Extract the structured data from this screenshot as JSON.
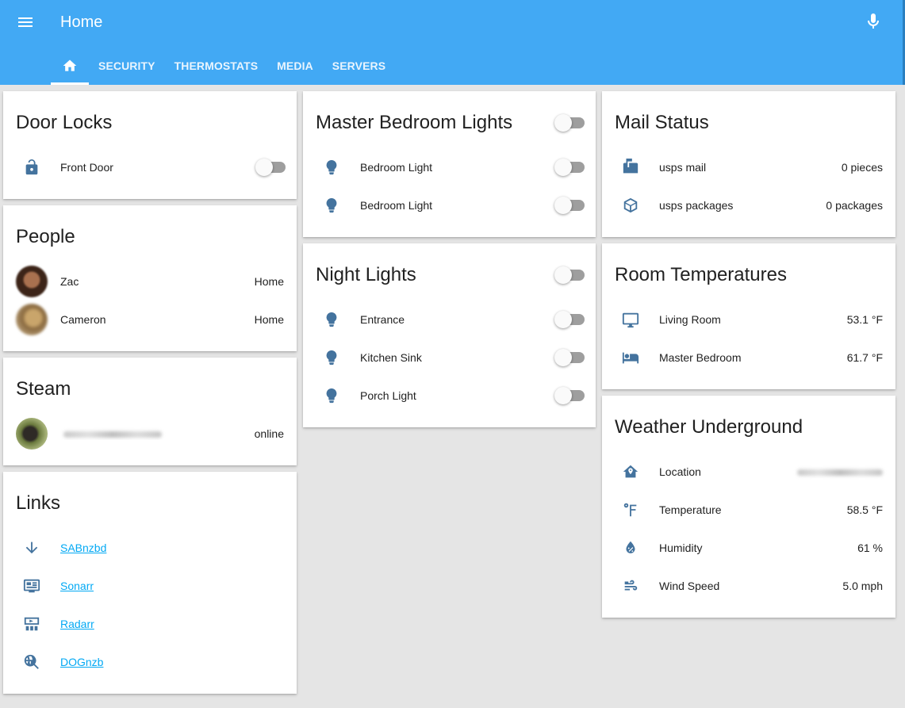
{
  "header": {
    "title": "Home",
    "tabs": [
      "SECURITY",
      "THERMOSTATS",
      "MEDIA",
      "SERVERS"
    ]
  },
  "door_locks": {
    "title": "Door Locks",
    "items": [
      {
        "label": "Front Door",
        "icon": "lock-open-icon",
        "state": "off"
      }
    ]
  },
  "people": {
    "title": "People",
    "items": [
      {
        "name": "Zac",
        "state": "Home"
      },
      {
        "name": "Cameron",
        "state": "Home"
      }
    ]
  },
  "steam": {
    "title": "Steam",
    "items": [
      {
        "name": "",
        "state": "online"
      }
    ]
  },
  "links": {
    "title": "Links",
    "items": [
      {
        "label": "SABnzbd",
        "icon": "arrow-down-icon"
      },
      {
        "label": "Sonarr",
        "icon": "tv-guide-icon"
      },
      {
        "label": "Radarr",
        "icon": "theater-icon"
      },
      {
        "label": "DOGnzb",
        "icon": "web-search-icon"
      }
    ]
  },
  "master_bedroom": {
    "title": "Master Bedroom Lights",
    "items": [
      {
        "label": "Bedroom Light",
        "state": "off"
      },
      {
        "label": "Bedroom Light",
        "state": "off"
      }
    ]
  },
  "night_lights": {
    "title": "Night Lights",
    "items": [
      {
        "label": "Entrance",
        "state": "off"
      },
      {
        "label": "Kitchen Sink",
        "state": "off"
      },
      {
        "label": "Porch Light",
        "state": "off"
      }
    ]
  },
  "mail_status": {
    "title": "Mail Status",
    "items": [
      {
        "label": "usps mail",
        "value": "0 pieces",
        "icon": "mailbox-icon"
      },
      {
        "label": "usps packages",
        "value": "0 packages",
        "icon": "package-icon"
      }
    ]
  },
  "room_temps": {
    "title": "Room Temperatures",
    "items": [
      {
        "label": "Living Room",
        "value": "53.1 °F",
        "icon": "monitor-icon"
      },
      {
        "label": "Master Bedroom",
        "value": "61.7 °F",
        "icon": "bed-icon"
      }
    ]
  },
  "weather": {
    "title": "Weather Underground",
    "items": [
      {
        "label": "Location",
        "value": "",
        "icon": "home-map-marker-icon"
      },
      {
        "label": "Temperature",
        "value": "58.5 °F",
        "icon": "fahrenheit-icon"
      },
      {
        "label": "Humidity",
        "value": "61 %",
        "icon": "water-percent-icon"
      },
      {
        "label": "Wind Speed",
        "value": "5.0 mph",
        "icon": "weather-windy-icon"
      }
    ]
  },
  "colors": {
    "header": "#42a9f4",
    "icon": "#44739e",
    "link": "#03a9f4",
    "background": "#e5e5e5"
  }
}
